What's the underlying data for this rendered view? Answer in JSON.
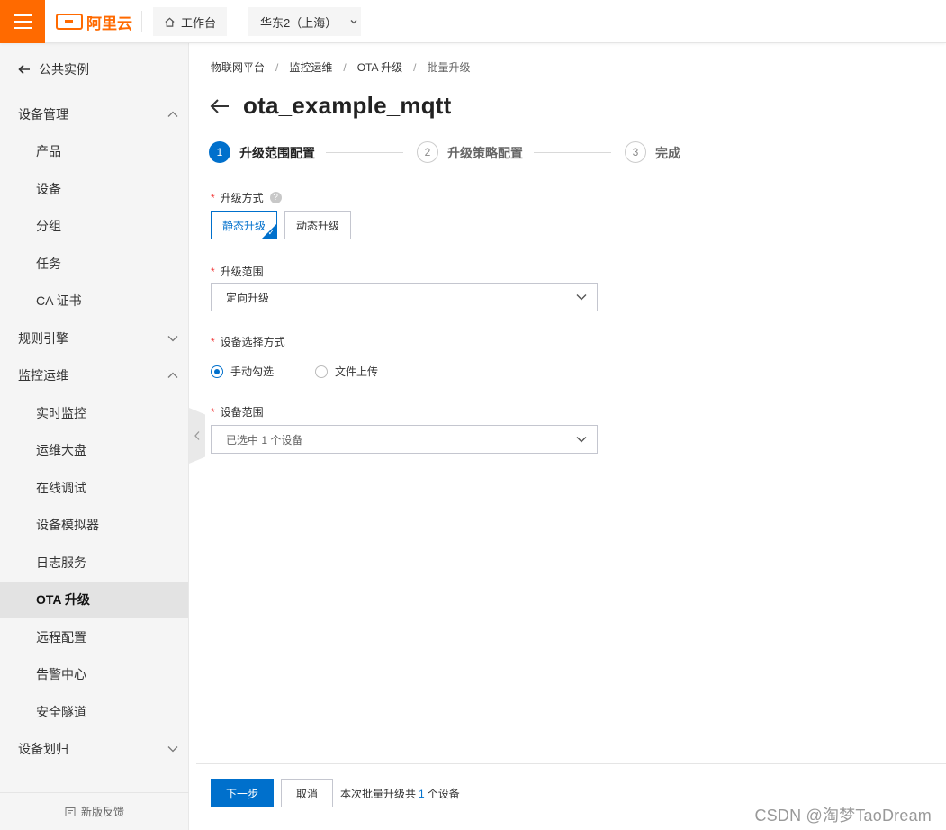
{
  "topbar": {
    "logo_text": "阿里云",
    "workbench_label": "工作台",
    "region_label": "华东2（上海）"
  },
  "sidebar": {
    "back_label": "公共实例",
    "groups": [
      {
        "label": "设备管理",
        "expanded": true,
        "items": [
          "产品",
          "设备",
          "分组",
          "任务",
          "CA 证书"
        ]
      },
      {
        "label": "规则引擎",
        "expanded": false,
        "items": []
      },
      {
        "label": "监控运维",
        "expanded": true,
        "items": [
          "实时监控",
          "运维大盘",
          "在线调试",
          "设备模拟器",
          "日志服务",
          "OTA 升级",
          "远程配置",
          "告警中心",
          "安全隧道"
        ]
      },
      {
        "label": "设备划归",
        "expanded": false,
        "items": []
      }
    ],
    "active_item": "OTA 升级",
    "feedback_label": "新版反馈"
  },
  "breadcrumb": [
    "物联网平台",
    "监控运维",
    "OTA 升级",
    "批量升级"
  ],
  "page_title": "ota_example_mqtt",
  "steps": [
    {
      "num": "1",
      "label": "升级范围配置",
      "active": true
    },
    {
      "num": "2",
      "label": "升级策略配置",
      "active": false
    },
    {
      "num": "3",
      "label": "完成",
      "active": false
    }
  ],
  "form": {
    "upgrade_mode": {
      "label": "升级方式",
      "options": [
        "静态升级",
        "动态升级"
      ],
      "selected": "静态升级"
    },
    "upgrade_scope": {
      "label": "升级范围",
      "value": "定向升级"
    },
    "device_select_mode": {
      "label": "设备选择方式",
      "options": [
        "手动勾选",
        "文件上传"
      ],
      "selected": "手动勾选"
    },
    "device_scope": {
      "label": "设备范围",
      "value": "已选中 1 个设备"
    }
  },
  "footer": {
    "next_label": "下一步",
    "cancel_label": "取消",
    "summary_prefix": "本次批量升级共",
    "summary_count": "1",
    "summary_suffix": "个设备"
  },
  "watermark": "CSDN @淘梦TaoDream",
  "colors": {
    "brand": "#ff6a00",
    "primary": "#0070cc",
    "required": "#f23c3c"
  }
}
